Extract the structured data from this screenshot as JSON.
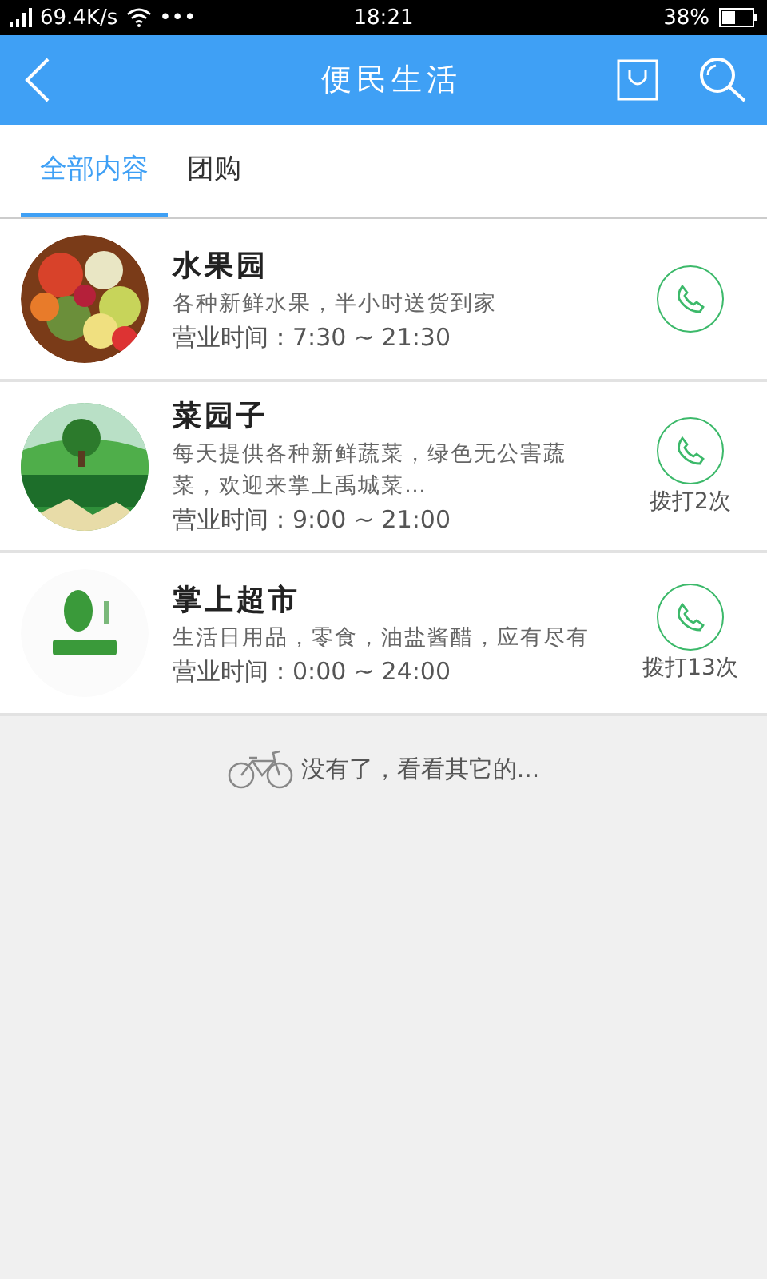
{
  "status_bar": {
    "speed": "69.4K/s",
    "more": "•••",
    "time": "18:21",
    "battery": "38%"
  },
  "header": {
    "title": "便民生活"
  },
  "tabs": [
    {
      "label": "全部内容",
      "selected": true
    },
    {
      "label": "团购",
      "selected": false
    }
  ],
  "stores": [
    {
      "name": "水果园",
      "description": "各种新鲜水果，半小时送货到家",
      "hours": "营业时间：7:30  ~  21:30"
    },
    {
      "name": "菜园子",
      "description": "每天提供各种新鲜蔬菜，绿色无公害蔬菜，欢迎来掌上禹城菜…",
      "hours": "营业时间：9:00  ~  21:00",
      "call_count": "拨打2次"
    },
    {
      "name": "掌上超市",
      "description": "生活日用品，零食，油盐酱醋，应有尽有",
      "hours": "营业时间：0:00  ~  24:00",
      "call_count": "拨打13次"
    }
  ],
  "end_message": "没有了，看看其它的..."
}
